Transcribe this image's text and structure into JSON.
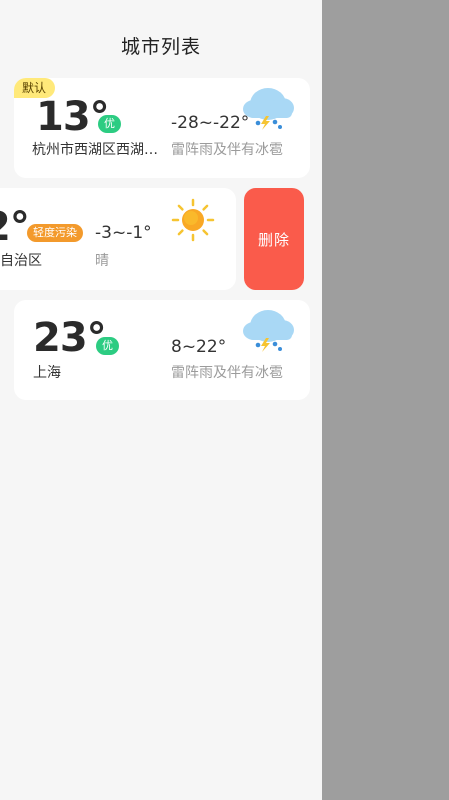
{
  "header": {
    "title": "城市列表"
  },
  "cities": [
    {
      "default_badge": "默认",
      "temperature": "13°",
      "aqi": "优",
      "range": "-28~-22°",
      "name": "杭州市西湖区西湖…",
      "weather": "雷阵雨及伴有冰雹",
      "icon": "thunderstorm-hail-cloud-icon"
    },
    {
      "temperature": "2°",
      "aqi": "轻度污染",
      "range": "-3~-1°",
      "name": "自治区",
      "weather": "晴",
      "icon": "sun-icon"
    },
    {
      "temperature": "23°",
      "aqi": "优",
      "range": "8~22°",
      "name": "上海",
      "weather": "雷阵雨及伴有冰雹",
      "icon": "thunderstorm-hail-cloud-icon"
    }
  ],
  "actions": {
    "delete_label": "删除"
  },
  "colors": {
    "aqi_good": "#2ccc82",
    "aqi_light_pollution": "#f39a2c",
    "delete": "#fa5b4b",
    "default_badge": "#ffe97a",
    "scrim": "#9e9e9e"
  }
}
